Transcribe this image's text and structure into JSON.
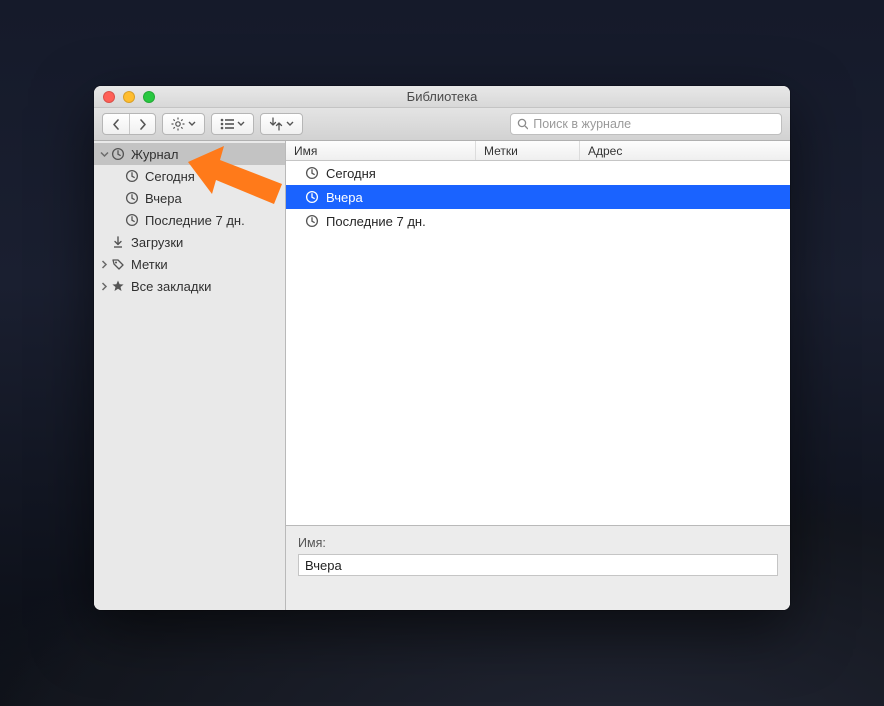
{
  "window_title": "Библиотека",
  "search": {
    "placeholder": "Поиск в журнале"
  },
  "sidebar": {
    "items": [
      {
        "label": "Журнал",
        "icon": "clock-icon",
        "has_children": true,
        "expanded": true,
        "selected": true,
        "depth": 0
      },
      {
        "label": "Сегодня",
        "icon": "clock-icon",
        "has_children": false,
        "expanded": false,
        "selected": false,
        "depth": 1
      },
      {
        "label": "Вчера",
        "icon": "clock-icon",
        "has_children": false,
        "expanded": false,
        "selected": false,
        "depth": 1
      },
      {
        "label": "Последние 7 дн.",
        "icon": "clock-icon",
        "has_children": false,
        "expanded": false,
        "selected": false,
        "depth": 1
      },
      {
        "label": "Загрузки",
        "icon": "download-icon",
        "has_children": false,
        "expanded": false,
        "selected": false,
        "depth": 0
      },
      {
        "label": "Метки",
        "icon": "tag-icon",
        "has_children": true,
        "expanded": false,
        "selected": false,
        "depth": 0
      },
      {
        "label": "Все закладки",
        "icon": "star-icon",
        "has_children": true,
        "expanded": false,
        "selected": false,
        "depth": 0
      }
    ]
  },
  "columns": {
    "name": "Имя",
    "tags": "Метки",
    "address": "Адрес"
  },
  "rows": [
    {
      "label": "Сегодня",
      "icon": "clock-icon",
      "selected": false
    },
    {
      "label": "Вчера",
      "icon": "clock-icon",
      "selected": true
    },
    {
      "label": "Последние 7 дн.",
      "icon": "clock-icon",
      "selected": false
    }
  ],
  "detail": {
    "label": "Имя:",
    "value": "Вчера"
  },
  "colors": {
    "selection": "#1a63ff",
    "arrow": "#ff7a1a"
  }
}
